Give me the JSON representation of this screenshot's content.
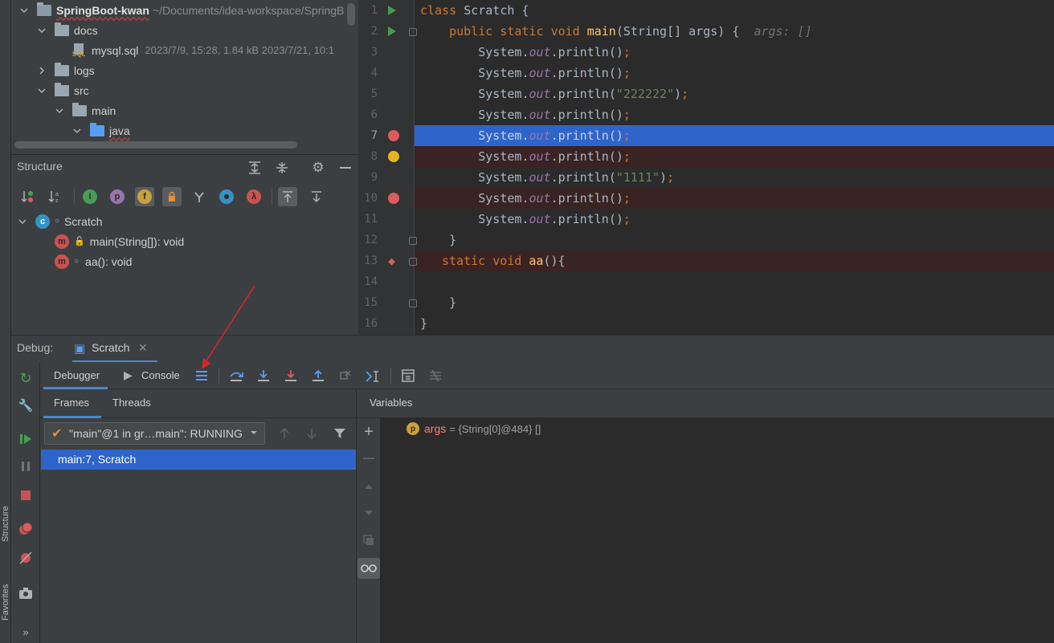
{
  "project_tree": {
    "root_name": "SpringBoot-kwan",
    "root_path": "~/Documents/idea-workspace/SpringB",
    "items": [
      {
        "label": "docs"
      },
      {
        "label": "mysql.sql",
        "meta": "2023/7/9, 15:28, 1.84 kB 2023/7/21, 10:1"
      },
      {
        "label": "logs"
      },
      {
        "label": "src"
      },
      {
        "label": "main"
      },
      {
        "label": "java"
      }
    ],
    "sql_badge": "SQL"
  },
  "structure": {
    "title": "Structure",
    "class_name": "Scratch",
    "members": [
      {
        "label": "main(String[]): void",
        "badge": "m"
      },
      {
        "label": "aa(): void",
        "badge": "m"
      }
    ],
    "filter_icons": [
      {
        "glyph": "I",
        "color": "#499c54"
      },
      {
        "glyph": "p",
        "color": "#9876aa"
      },
      {
        "glyph": "f",
        "color": "#c9a03d"
      },
      {
        "glyph": "λ",
        "color": "#c75450"
      }
    ]
  },
  "editor": {
    "line_numbers": [
      "1",
      "2",
      "3",
      "4",
      "5",
      "6",
      "7",
      "8",
      "9",
      "10",
      "11",
      "12",
      "13",
      "14",
      "15",
      "16"
    ],
    "inlay_hint": "args: []",
    "strings": {
      "s222": "\"222222\"",
      "s111": "\"1111\""
    },
    "kw": {
      "class": "class",
      "public": "public",
      "static": "static",
      "void": "void"
    },
    "identifiers": {
      "scratch": "Scratch",
      "main": "main",
      "string": "String",
      "args": "args",
      "system": "System",
      "out": "out",
      "println": "println",
      "aa": "aa"
    },
    "colors": {
      "current_line": "#2f65ca",
      "breakpoint_line": "#3a2323",
      "breakpoint": "#db5c5c",
      "run": "#499c54"
    }
  },
  "debug": {
    "label": "Debug:",
    "session_tab": "Scratch",
    "tabs": {
      "debugger": "Debugger",
      "console": "Console"
    },
    "subtabs": {
      "frames": "Frames",
      "threads": "Threads"
    },
    "thread_select": "\"main\"@1 in gr…main\": RUNNING",
    "frames": [
      {
        "label": "main:7, Scratch"
      }
    ],
    "variables_title": "Variables",
    "variables": [
      {
        "badge": "p",
        "name": "args",
        "value": "= {String[0]@484} []"
      }
    ]
  }
}
